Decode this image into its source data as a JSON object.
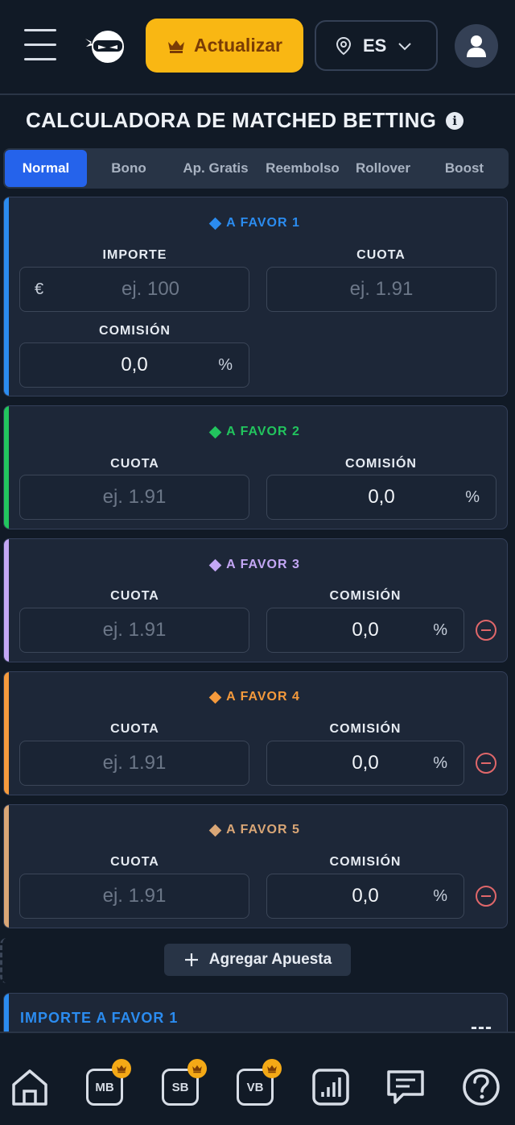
{
  "header": {
    "upgrade_label": "Actualizar",
    "language_code": "ES"
  },
  "page": {
    "title": "CALCULADORA DE MATCHED BETTING"
  },
  "tabs": [
    {
      "label": "Normal",
      "active": true
    },
    {
      "label": "Bono",
      "active": false
    },
    {
      "label": "Ap. Gratis",
      "active": false
    },
    {
      "label": "Reembolso",
      "active": false
    },
    {
      "label": "Rollover",
      "active": false
    },
    {
      "label": "Boost",
      "active": false
    }
  ],
  "bets": [
    {
      "title": "A FAVOR 1",
      "color": "#2b8cf0",
      "importe_label": "IMPORTE",
      "importe_prefix": "€",
      "importe_placeholder": "ej. 100",
      "cuota_label": "CUOTA",
      "cuota_placeholder": "ej. 1.91",
      "comision_label": "COMISIÓN",
      "comision_value": "0,0",
      "comision_suffix": "%"
    },
    {
      "title": "A FAVOR 2",
      "color": "#22c55e",
      "cuota_label": "CUOTA",
      "cuota_placeholder": "ej. 1.91",
      "comision_label": "COMISIÓN",
      "comision_value": "0,0",
      "comision_suffix": "%"
    },
    {
      "title": "A FAVOR 3",
      "color": "#c4a7f5",
      "cuota_label": "CUOTA",
      "cuota_placeholder": "ej. 1.91",
      "comision_label": "COMISIÓN",
      "comision_value": "0,0",
      "comision_suffix": "%"
    },
    {
      "title": "A FAVOR 4",
      "color": "#f59a3c",
      "cuota_label": "CUOTA",
      "cuota_placeholder": "ej. 1.91",
      "comision_label": "COMISIÓN",
      "comision_value": "0,0",
      "comision_suffix": "%"
    },
    {
      "title": "A FAVOR 5",
      "color": "#d9a676",
      "cuota_label": "CUOTA",
      "cuota_placeholder": "ej. 1.91",
      "comision_label": "COMISIÓN",
      "comision_value": "0,0",
      "comision_suffix": "%"
    }
  ],
  "add_bet_label": "Agregar Apuesta",
  "result": {
    "label": "IMPORTE A FAVOR 1",
    "value": "---"
  },
  "bottom_nav": [
    {
      "name": "home",
      "icon": "home-icon"
    },
    {
      "name": "mb",
      "text": "MB",
      "icon": "crown-icon"
    },
    {
      "name": "sb",
      "text": "SB",
      "icon": "crown-icon"
    },
    {
      "name": "vb",
      "text": "VB",
      "icon": "crown-icon"
    },
    {
      "name": "stats",
      "icon": "bar-chart-icon"
    },
    {
      "name": "messages",
      "icon": "chat-icon"
    },
    {
      "name": "help",
      "icon": "help-icon"
    }
  ],
  "colors": {
    "accent": "#2563eb",
    "upgrade": "#f9b713",
    "remove": "#e0676a"
  }
}
